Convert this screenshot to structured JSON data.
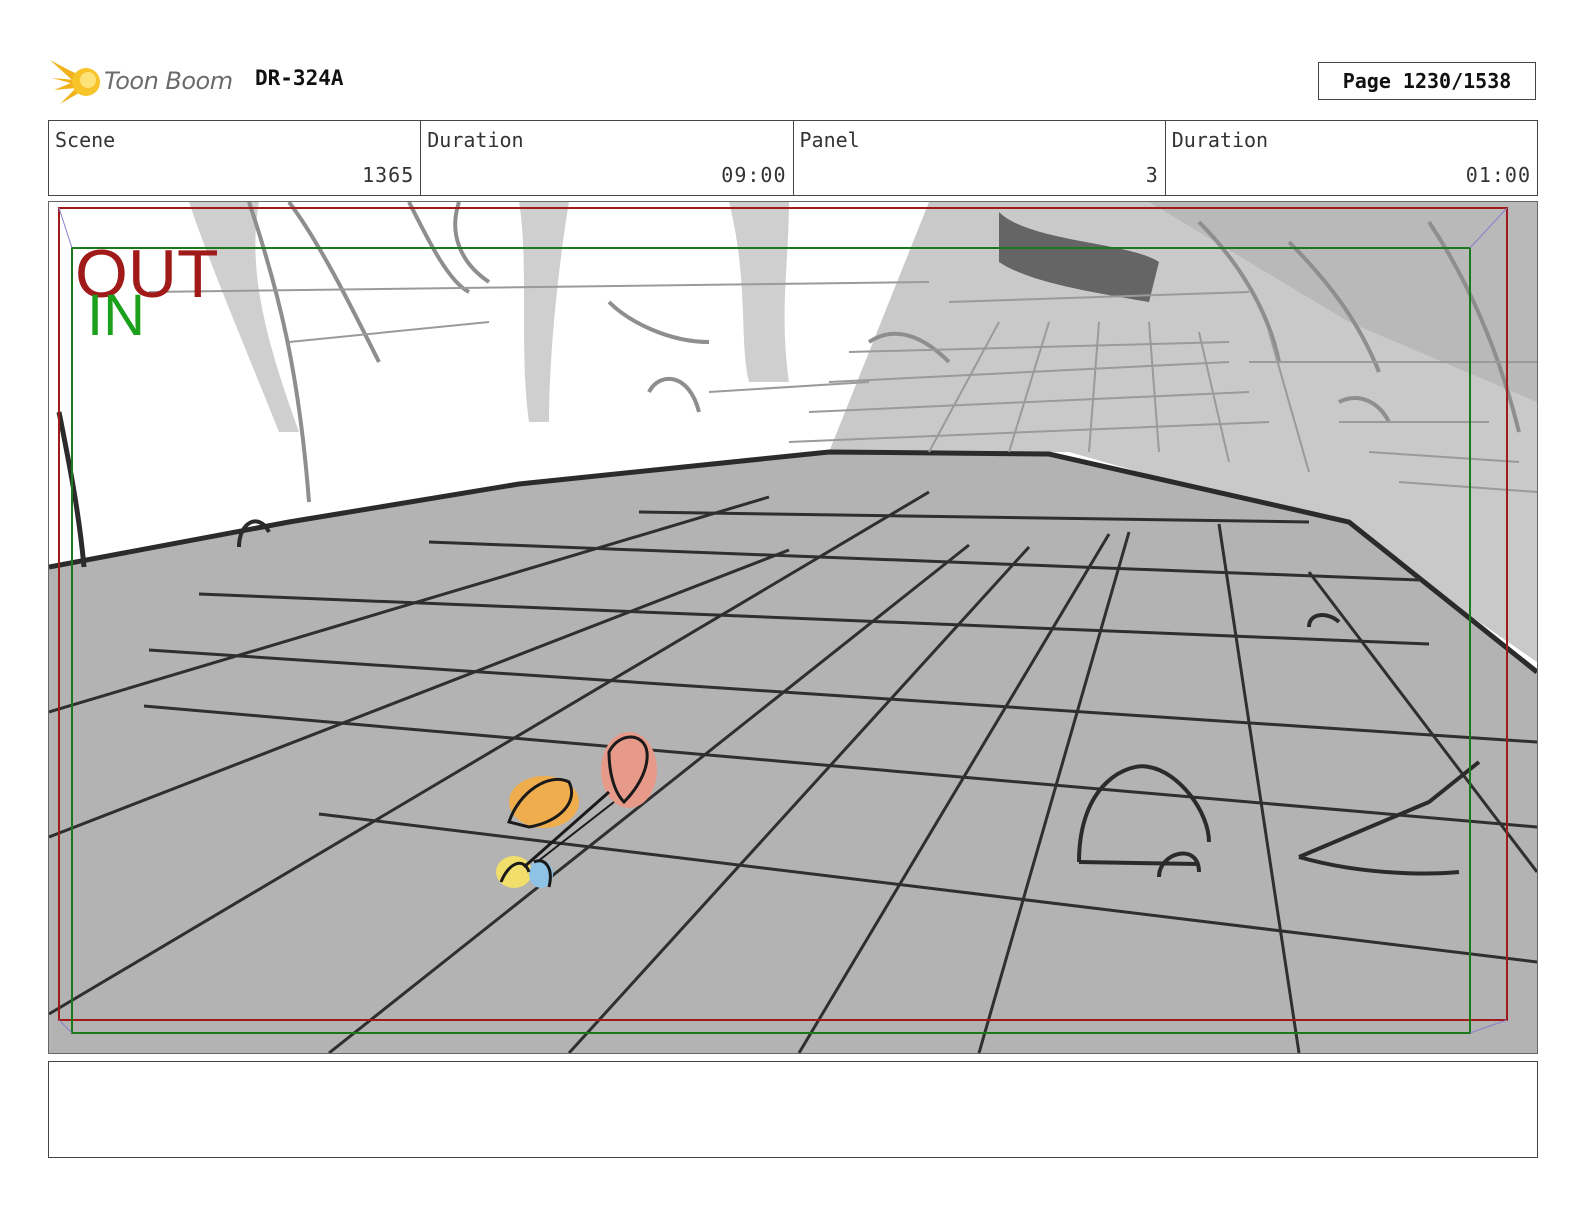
{
  "header": {
    "logo_text": "Toon Boom",
    "project_code": "DR-324A",
    "page_label": "Page 1230/1538"
  },
  "info": {
    "scene_label": "Scene",
    "scene_value": "1365",
    "scene_duration_label": "Duration",
    "scene_duration_value": "09:00",
    "panel_label": "Panel",
    "panel_value": "3",
    "panel_duration_label": "Duration",
    "panel_duration_value": "01:00"
  },
  "frame": {
    "out_label": "OUT",
    "in_label": "IN",
    "out_color": "#a01a1a",
    "in_color": "#1aa01a"
  },
  "notes": {
    "text": ""
  }
}
